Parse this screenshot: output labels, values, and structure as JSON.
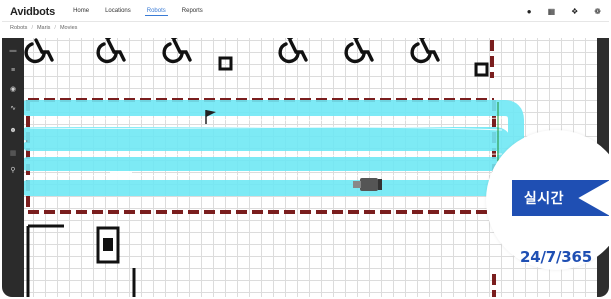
{
  "header": {
    "brand": "Avidbots",
    "nav": [
      "Home",
      "Locations",
      "Robots",
      "Reports"
    ],
    "active_nav": "Robots",
    "icons": [
      "bell-icon",
      "cart-icon",
      "help-icon",
      "settings-icon"
    ]
  },
  "breadcrumb": [
    "Robots",
    "Maris",
    "Movies"
  ],
  "rail": {
    "icons": [
      "dashboard-icon",
      "list-icon",
      "location-icon",
      "feed-icon",
      "users-icon",
      "grid-icon",
      "pin-icon"
    ]
  },
  "map": {
    "symbols": [
      "accessibility-icon",
      "stop-sign-icon",
      "flag-icon",
      "robot-icon",
      "door-icon"
    ]
  },
  "badge": {
    "label": "실시간",
    "hours": "24/7/365"
  },
  "colors": {
    "path": "#6fe8f5",
    "boundary": "#7a1e1e",
    "badge": "#1f4fb3"
  }
}
